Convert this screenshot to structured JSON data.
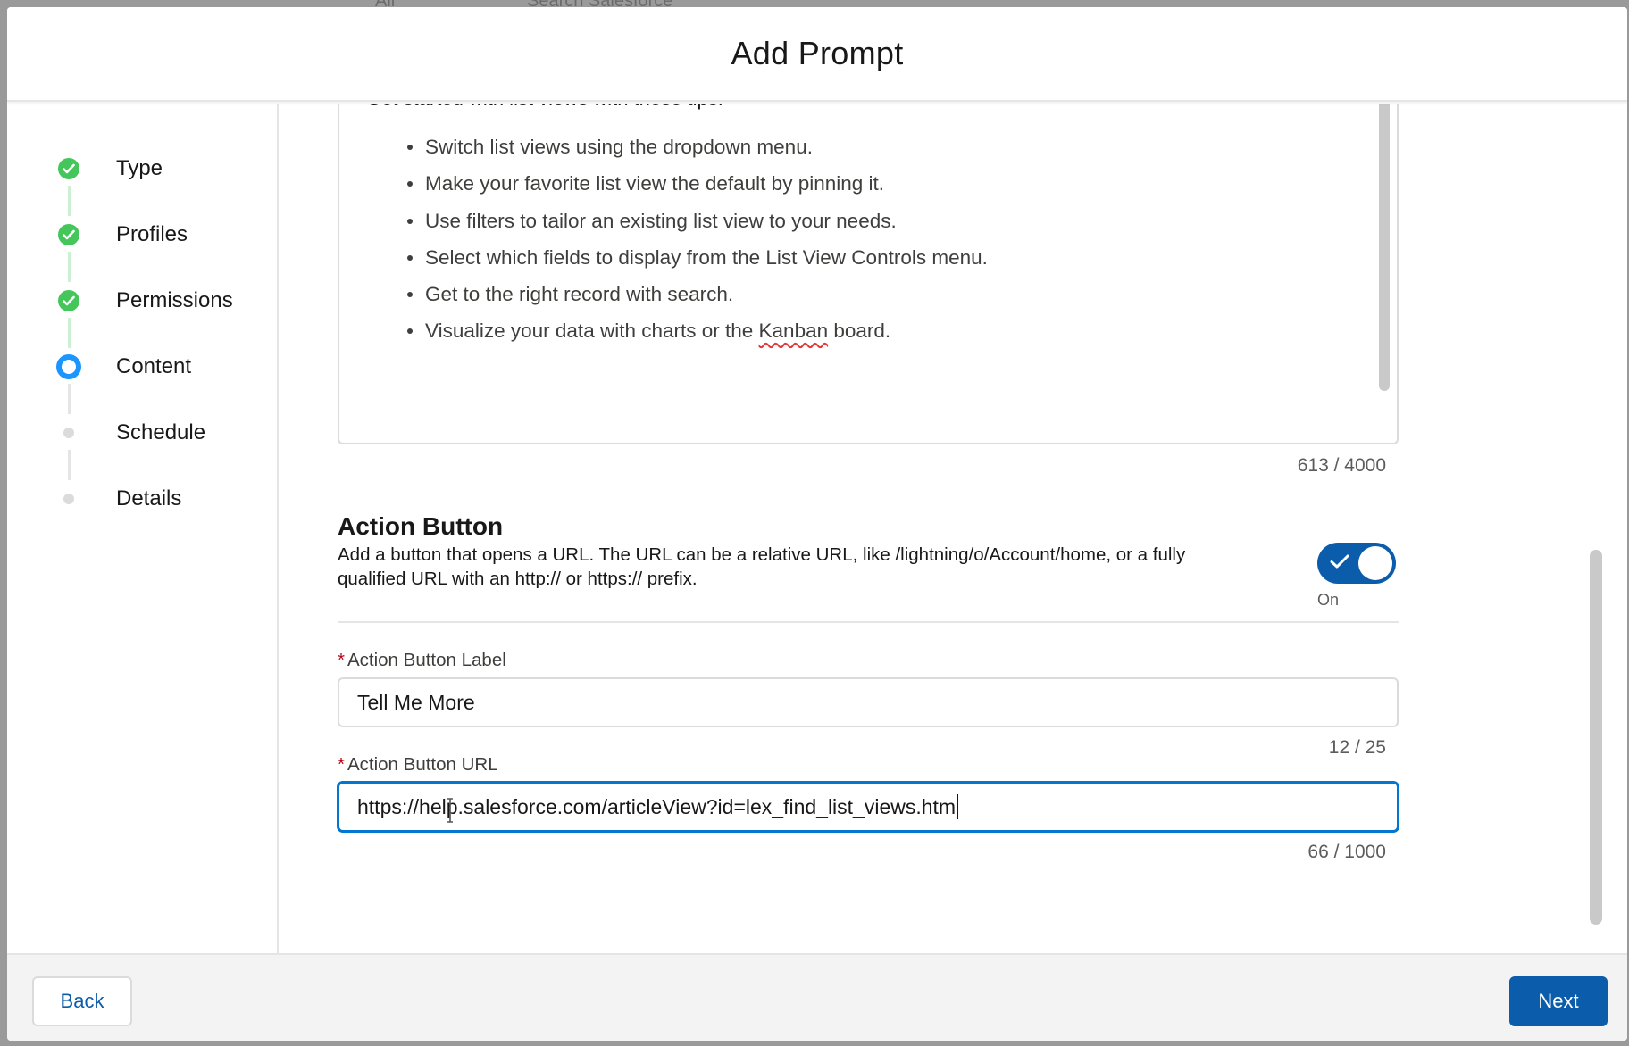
{
  "background_app": {
    "scope_label": "All",
    "search_placeholder": "Search Salesforce"
  },
  "modal": {
    "title": "Add Prompt"
  },
  "stepper": {
    "steps": [
      {
        "label": "Type",
        "status": "complete"
      },
      {
        "label": "Profiles",
        "status": "complete"
      },
      {
        "label": "Permissions",
        "status": "complete"
      },
      {
        "label": "Content",
        "status": "active"
      },
      {
        "label": "Schedule",
        "status": "incomplete"
      },
      {
        "label": "Details",
        "status": "incomplete"
      }
    ]
  },
  "content": {
    "body_intro": "Get started with list views with these tips:",
    "tips": [
      "Switch list views using the dropdown menu.",
      "Make your favorite list view the default by pinning it.",
      "Use filters to tailor an existing list view to your needs.",
      "Select which fields to display from the List View Controls menu.",
      "Get to the right record with search."
    ],
    "tip_last_before": "Visualize your data with charts or the ",
    "tip_last_word": "Kanban",
    "tip_last_after": " board.",
    "body_counter": "613 / 4000"
  },
  "action_button": {
    "title": "Action Button",
    "description": "Add a button that opens a URL. The URL can be a relative URL, like /lightning/o/Account/home, or a fully qualified URL with an http:// or https:// prefix.",
    "toggle_state": "On",
    "toggle_on": true,
    "label_field": {
      "required_mark": "*",
      "label": "Action Button Label",
      "value": "Tell Me More",
      "counter": "12 / 25"
    },
    "url_field": {
      "required_mark": "*",
      "label": "Action Button URL",
      "value": "https://help.salesforce.com/articleView?id=lex_find_list_views.htm",
      "counter": "66 / 1000"
    }
  },
  "footer": {
    "back_label": "Back",
    "next_label": "Next"
  },
  "colors": {
    "brand": "#0b5cab",
    "success": "#45c65a",
    "active_step": "#1b96ff",
    "required": "#ba0517"
  }
}
